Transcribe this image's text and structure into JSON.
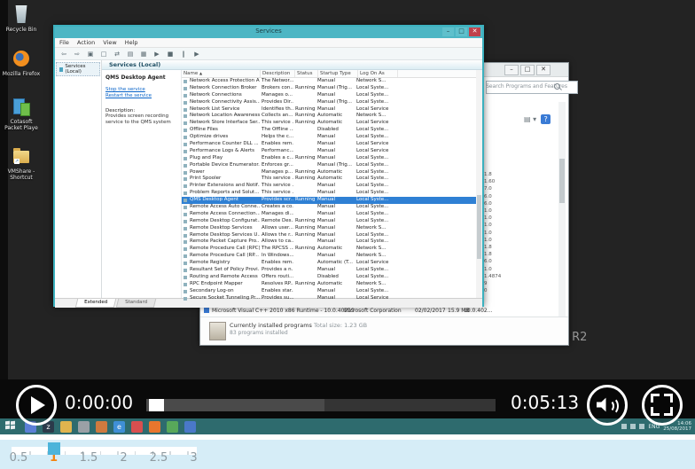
{
  "desktop": {
    "icons": [
      {
        "label": "Recycle Bin"
      },
      {
        "label": "Mozilla Firefox"
      },
      {
        "label": "Cotasoft Packet Playe"
      },
      {
        "label": "VMShare - Shortcut"
      }
    ],
    "watermark": "Windows Server 2012 R2"
  },
  "services_window": {
    "title": "Services",
    "menus": [
      {
        "label": "File"
      },
      {
        "label": "Action"
      },
      {
        "label": "View"
      },
      {
        "label": "Help"
      }
    ],
    "toolbar_icons": [
      {
        "g": "⇦"
      },
      {
        "g": "⇨"
      },
      {
        "g": "▣"
      },
      {
        "g": "□"
      },
      {
        "g": "⇄"
      },
      {
        "g": "▤"
      },
      {
        "g": "▦"
      },
      {
        "g": "▶"
      },
      {
        "g": "■"
      },
      {
        "g": "‖"
      },
      {
        "g": "▶"
      }
    ],
    "tree_item": "Services (Local)",
    "panel_header": "Services (Local)",
    "selected_service": "QMS Desktop Agent",
    "stop_link": "Stop the service",
    "restart_link": "Restart the service",
    "description_label": "Description:",
    "description": "Provides screen recording service to the QMS system",
    "columns": {
      "name": "Name",
      "sort": "▲",
      "description": "Description",
      "status": "Status",
      "startup": "Startup Type",
      "logon": "Log On As"
    },
    "rows": [
      {
        "name": "Network Access Protection A...",
        "desc": "The Networ...",
        "status": "",
        "startup": "Manual",
        "logon": "Network S..."
      },
      {
        "name": "Network Connection Broker",
        "desc": "Brokers con...",
        "status": "Running",
        "startup": "Manual (Trig...",
        "logon": "Local Syste..."
      },
      {
        "name": "Network Connections",
        "desc": "Manages o...",
        "status": "",
        "startup": "Manual",
        "logon": "Local Syste..."
      },
      {
        "name": "Network Connectivity Assis...",
        "desc": "Provides Dir...",
        "status": "",
        "startup": "Manual (Trig...",
        "logon": "Local Syste..."
      },
      {
        "name": "Network List Service",
        "desc": "Identifies th...",
        "status": "Running",
        "startup": "Manual",
        "logon": "Local Service"
      },
      {
        "name": "Network Location Awareness",
        "desc": "Collects an...",
        "status": "Running",
        "startup": "Automatic",
        "logon": "Network S..."
      },
      {
        "name": "Network Store Interface Ser...",
        "desc": "This service ...",
        "status": "Running",
        "startup": "Automatic",
        "logon": "Local Service"
      },
      {
        "name": "Offline Files",
        "desc": "The Offline ...",
        "status": "",
        "startup": "Disabled",
        "logon": "Local Syste..."
      },
      {
        "name": "Optimize drives",
        "desc": "Helps the c...",
        "status": "",
        "startup": "Manual",
        "logon": "Local Syste..."
      },
      {
        "name": "Performance Counter DLL ...",
        "desc": "Enables rem...",
        "status": "",
        "startup": "Manual",
        "logon": "Local Service"
      },
      {
        "name": "Performance Logs & Alerts",
        "desc": "Performanc...",
        "status": "",
        "startup": "Manual",
        "logon": "Local Service"
      },
      {
        "name": "Plug and Play",
        "desc": "Enables a c...",
        "status": "Running",
        "startup": "Manual",
        "logon": "Local Syste..."
      },
      {
        "name": "Portable Device Enumerator...",
        "desc": "Enforces gr...",
        "status": "",
        "startup": "Manual (Trig...",
        "logon": "Local Syste..."
      },
      {
        "name": "Power",
        "desc": "Manages p...",
        "status": "Running",
        "startup": "Automatic",
        "logon": "Local Syste..."
      },
      {
        "name": "Print Spooler",
        "desc": "This service ...",
        "status": "Running",
        "startup": "Automatic",
        "logon": "Local Syste..."
      },
      {
        "name": "Printer Extensions and Notif...",
        "desc": "This service ...",
        "status": "",
        "startup": "Manual",
        "logon": "Local Syste..."
      },
      {
        "name": "Problem Reports and Solut...",
        "desc": "This service ...",
        "status": "",
        "startup": "Manual",
        "logon": "Local Syste..."
      },
      {
        "name": "QMS Desktop Agent",
        "desc": "Provides scr...",
        "status": "Running",
        "startup": "Manual",
        "logon": "Local Syste...",
        "selected": true
      },
      {
        "name": "Remote Access Auto Conne...",
        "desc": "Creates a co...",
        "status": "",
        "startup": "Manual",
        "logon": "Local Syste..."
      },
      {
        "name": "Remote Access Connection...",
        "desc": "Manages di...",
        "status": "",
        "startup": "Manual",
        "logon": "Local Syste..."
      },
      {
        "name": "Remote Desktop Configurat...",
        "desc": "Remote Des...",
        "status": "Running",
        "startup": "Manual",
        "logon": "Local Syste..."
      },
      {
        "name": "Remote Desktop Services",
        "desc": "Allows user...",
        "status": "Running",
        "startup": "Manual",
        "logon": "Network S..."
      },
      {
        "name": "Remote Desktop Services U...",
        "desc": "Allows the r...",
        "status": "Running",
        "startup": "Manual",
        "logon": "Local Syste..."
      },
      {
        "name": "Remote Packet Capture Pro...",
        "desc": "Allows to ca...",
        "status": "",
        "startup": "Manual",
        "logon": "Local Syste..."
      },
      {
        "name": "Remote Procedure Call (RPC)",
        "desc": "The RPCSS ...",
        "status": "Running",
        "startup": "Automatic",
        "logon": "Network S..."
      },
      {
        "name": "Remote Procedure Call (RP...",
        "desc": "In Windows...",
        "status": "",
        "startup": "Manual",
        "logon": "Network S..."
      },
      {
        "name": "Remote Registry",
        "desc": "Enables rem...",
        "status": "",
        "startup": "Automatic (T...",
        "logon": "Local Service"
      },
      {
        "name": "Resultant Set of Policy Provi...",
        "desc": "Provides a n...",
        "status": "",
        "startup": "Manual",
        "logon": "Local Syste..."
      },
      {
        "name": "Routing and Remote Access",
        "desc": "Offers routi...",
        "status": "",
        "startup": "Disabled",
        "logon": "Local Syste..."
      },
      {
        "name": "RPC Endpoint Mapper",
        "desc": "Resolves RP...",
        "status": "Running",
        "startup": "Automatic",
        "logon": "Network S..."
      },
      {
        "name": "Secondary Log-on",
        "desc": "Enables star...",
        "status": "",
        "startup": "Manual",
        "logon": "Local Syste..."
      },
      {
        "name": "Secure Socket Tunneling Pr...",
        "desc": "Provides su...",
        "status": "",
        "startup": "Manual",
        "logon": "Local Service"
      }
    ],
    "tabs": {
      "extended": "Extended",
      "standard": "Standard"
    },
    "caption_buttons": {
      "minimize": "–",
      "maximize": "□",
      "close": "✕"
    },
    "accent_color": "#3cb1bf"
  },
  "programs_window": {
    "caption_buttons": {
      "minimize": "–",
      "maximize": "□",
      "close": "✕"
    },
    "search_placeholder": "Search Programs and Features",
    "version_fragments": [
      {
        "v": "1.8"
      },
      {
        "v": "1.60"
      },
      {
        "v": "7.0"
      },
      {
        "v": "6.0"
      },
      {
        "v": "6.0"
      },
      {
        "v": "1.0"
      },
      {
        "v": "1.0"
      },
      {
        "v": "1.0"
      },
      {
        "v": "1.0"
      },
      {
        "v": "1.0"
      },
      {
        "v": "1.8"
      },
      {
        "v": "1.8"
      },
      {
        "v": "6.0"
      },
      {
        "v": "1.0"
      },
      {
        "v": "1.4874"
      },
      {
        "v": "9"
      },
      {
        "v": "0"
      }
    ],
    "program_row": {
      "name": "Microsoft Visual C++ 2010 x86 Runtime - 10.0.40219",
      "publisher": "Microsoft Corporation",
      "date": "02/02/2017",
      "size": "15.9 MB",
      "version": "10.0.402..."
    },
    "status": {
      "line1": "Currently installed programs",
      "total_label": "Total size: 1.23 GB",
      "line2": "83 programs installed"
    }
  },
  "player": {
    "current_time": "0:00:00",
    "duration": "0:05:13",
    "loaded_pct": 51,
    "accent": "#ffffff"
  },
  "taskbar": {
    "language": "ENG",
    "time": "14:06",
    "date": "25/08/2017",
    "app_icons": [
      {
        "bg": "#5a7fd6",
        "g": ""
      },
      {
        "bg": "#2b3a4a",
        "g": "z"
      },
      {
        "bg": "#e0b44e",
        "g": ""
      },
      {
        "bg": "#9aa0a6",
        "g": ""
      },
      {
        "bg": "#cf7a3f",
        "g": ""
      },
      {
        "bg": "#3f8fd6",
        "g": "e"
      },
      {
        "bg": "#d94f4f",
        "g": ""
      },
      {
        "bg": "#e8762d",
        "g": ""
      },
      {
        "bg": "#58a85a",
        "g": ""
      },
      {
        "bg": "#4a78c9",
        "g": ""
      }
    ]
  },
  "speed_selector": {
    "labels": [
      {
        "label": "0.5",
        "value": 0.5
      },
      {
        "label": "1",
        "value": 1,
        "active": true
      },
      {
        "label": "1.5",
        "value": 1.5
      },
      {
        "label": "2",
        "value": 2
      },
      {
        "label": "2.5",
        "value": 2.5
      },
      {
        "label": "3",
        "value": 3
      }
    ],
    "active_value": 1,
    "handle_color": "#4cb4da",
    "active_label_color": "#f28410"
  }
}
